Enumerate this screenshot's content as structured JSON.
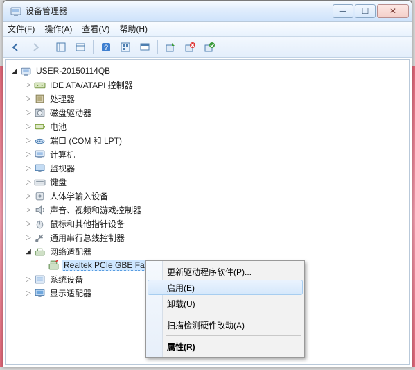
{
  "window": {
    "title": "设备管理器"
  },
  "menus": {
    "file": "文件(F)",
    "action": "操作(A)",
    "view": "查看(V)",
    "help": "帮助(H)"
  },
  "tree": {
    "root": "USER-20150114QB",
    "items": [
      {
        "label": "IDE ATA/ATAPI 控制器",
        "icon": "ide"
      },
      {
        "label": "处理器",
        "icon": "cpu"
      },
      {
        "label": "磁盘驱动器",
        "icon": "disk"
      },
      {
        "label": "电池",
        "icon": "battery"
      },
      {
        "label": "端口 (COM 和 LPT)",
        "icon": "port"
      },
      {
        "label": "计算机",
        "icon": "computer"
      },
      {
        "label": "监视器",
        "icon": "monitor"
      },
      {
        "label": "键盘",
        "icon": "keyboard"
      },
      {
        "label": "人体学输入设备",
        "icon": "hid"
      },
      {
        "label": "声音、视频和游戏控制器",
        "icon": "sound"
      },
      {
        "label": "鼠标和其他指针设备",
        "icon": "mouse"
      },
      {
        "label": "通用串行总线控制器",
        "icon": "usb"
      },
      {
        "label": "网络适配器",
        "icon": "net",
        "expanded": true,
        "children": [
          {
            "label": "Realtek PCIe GBE Family Controller",
            "icon": "netcard",
            "selected": true
          }
        ]
      },
      {
        "label": "系统设备",
        "icon": "system"
      },
      {
        "label": "显示适配器",
        "icon": "display"
      }
    ]
  },
  "context_menu": {
    "update_driver": "更新驱动程序软件(P)...",
    "enable": "启用(E)",
    "uninstall": "卸载(U)",
    "scan": "扫描检测硬件改动(A)",
    "properties": "属性(R)"
  }
}
